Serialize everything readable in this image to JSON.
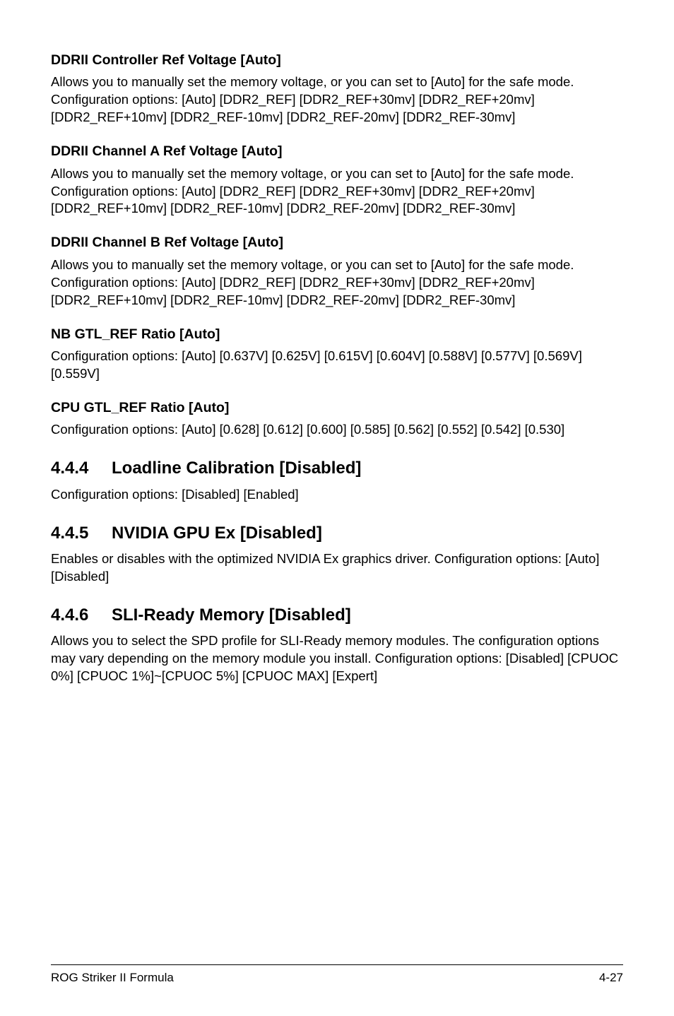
{
  "sections": {
    "s1": {
      "title": "DDRII Controller Ref Voltage [Auto]",
      "p1": "Allows you to manually set the memory voltage, or you can set to [Auto] for the safe mode.",
      "p2": "Configuration options: [Auto] [DDR2_REF] [DDR2_REF+30mv] [DDR2_REF+20mv] [DDR2_REF+10mv] [DDR2_REF-10mv] [DDR2_REF-20mv] [DDR2_REF-30mv]"
    },
    "s2": {
      "title": "DDRII Channel A Ref Voltage [Auto]",
      "p1": "Allows you to manually set the memory voltage, or you can set to [Auto] for the safe mode.",
      "p2": "Configuration options: [Auto] [DDR2_REF] [DDR2_REF+30mv] [DDR2_REF+20mv] [DDR2_REF+10mv] [DDR2_REF-10mv] [DDR2_REF-20mv] [DDR2_REF-30mv]"
    },
    "s3": {
      "title": "DDRII Channel B Ref Voltage [Auto]",
      "p1": "Allows you to manually set the memory voltage, or you can set to [Auto] for the safe mode.",
      "p2": "Configuration options: [Auto] [DDR2_REF] [DDR2_REF+30mv] [DDR2_REF+20mv] [DDR2_REF+10mv] [DDR2_REF-10mv] [DDR2_REF-20mv] [DDR2_REF-30mv]"
    },
    "s4": {
      "title": "NB GTL_REF Ratio [Auto]",
      "p1": "Configuration options: [Auto] [0.637V] [0.625V] [0.615V] [0.604V] [0.588V] [0.577V] [0.569V] [0.559V]"
    },
    "s5": {
      "title": "CPU GTL_REF Ratio [Auto]",
      "p1": "Configuration options: [Auto] [0.628] [0.612] [0.600] [0.585] [0.562] [0.552] [0.542] [0.530]"
    },
    "s6": {
      "num": "4.4.4",
      "title": "Loadline Calibration [Disabled]",
      "p1": "Configuration options: [Disabled] [Enabled]"
    },
    "s7": {
      "num": "4.4.5",
      "title": "NVIDIA GPU Ex [Disabled]",
      "p1": "Enables or disables with the optimized NVIDIA Ex graphics driver. Configuration options: [Auto] [Disabled]"
    },
    "s8": {
      "num": "4.4.6",
      "title": "SLI-Ready Memory [Disabled]",
      "p1": "Allows you to select the SPD profile for SLI-Ready memory modules. The configuration options may vary depending on the memory module you install. Configuration options: [Disabled] [CPUOC 0%] [CPUOC 1%]~[CPUOC 5%] [CPUOC MAX] [Expert]"
    }
  },
  "footer": {
    "left": "ROG Striker II Formula",
    "right": "4-27"
  }
}
